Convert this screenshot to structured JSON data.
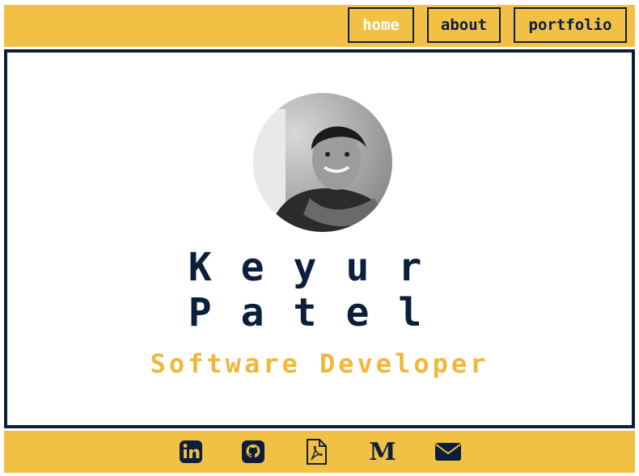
{
  "nav": {
    "items": [
      {
        "label": "home",
        "active": true
      },
      {
        "label": "about",
        "active": false
      },
      {
        "label": "portfolio",
        "active": false
      }
    ]
  },
  "profile": {
    "first_name": "Keyur",
    "last_name": "Patel",
    "title": "Software Developer"
  },
  "footer": {
    "icons": [
      "linkedin-icon",
      "github-icon",
      "pdf-resume-icon",
      "medium-icon",
      "email-icon"
    ]
  },
  "colors": {
    "accent": "#f2c044",
    "navy": "#0b1f3a",
    "subtitle": "#f0b83a"
  }
}
